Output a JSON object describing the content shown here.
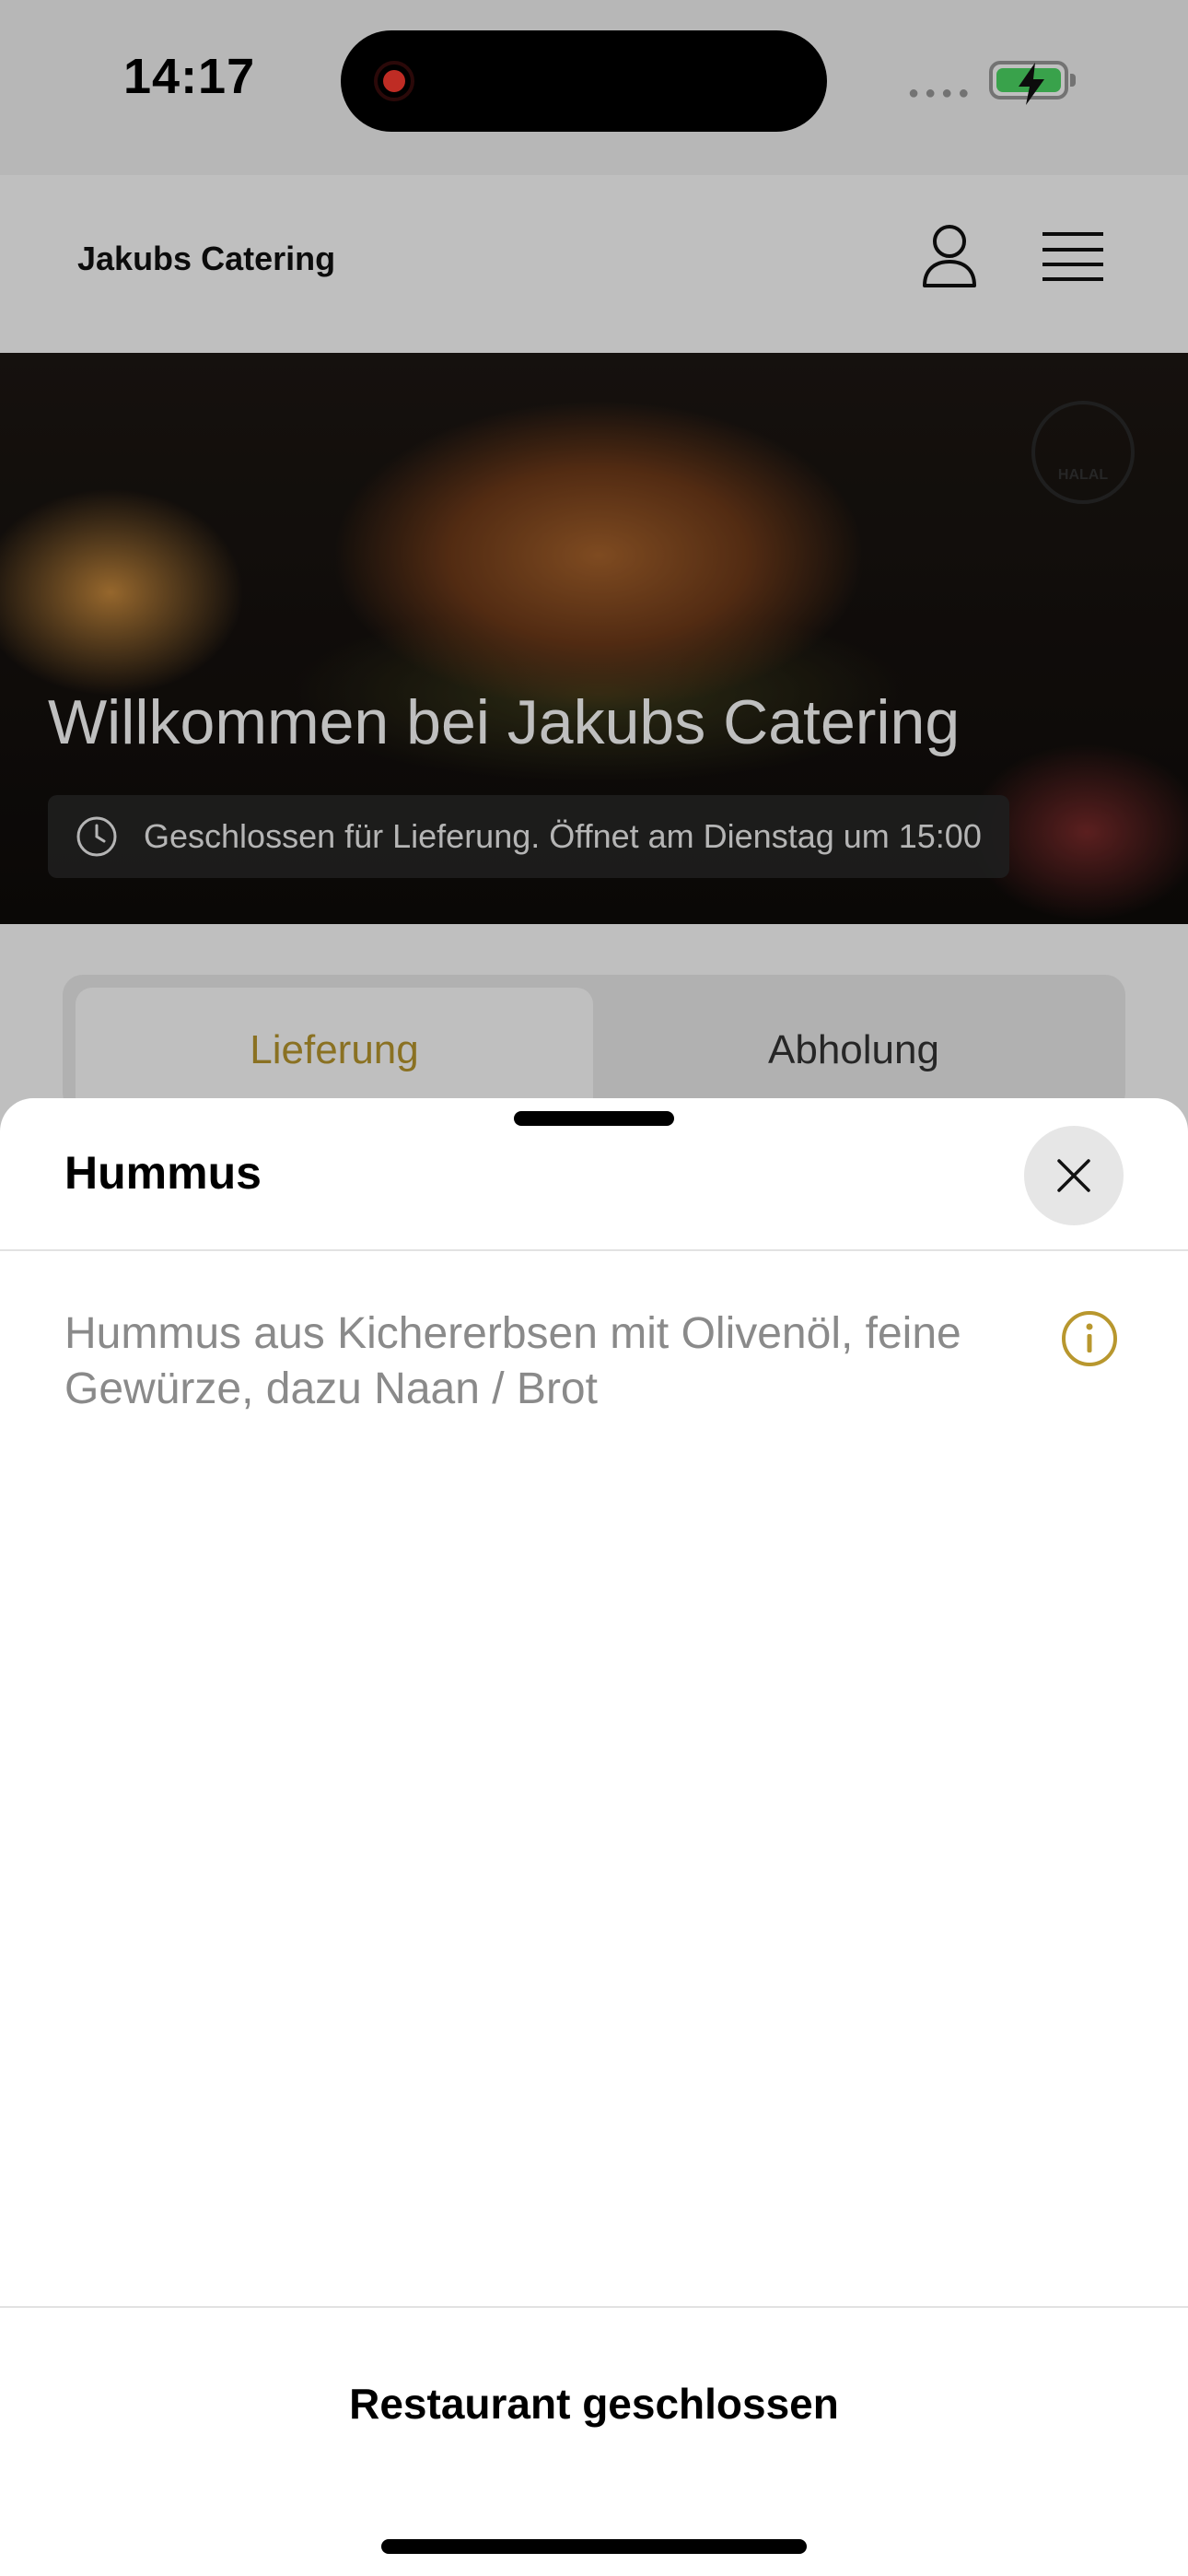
{
  "status_bar": {
    "time": "14:17"
  },
  "header": {
    "brand": "Jakubs Catering"
  },
  "hero": {
    "badge_text": "HALAL",
    "title": "Willkommen bei Jakubs Catering",
    "status": "Geschlossen für Lieferung. Öffnet am Dienstag um 15:00"
  },
  "tabs": [
    {
      "label": "Lieferung",
      "active": true
    },
    {
      "label": "Abholung",
      "active": false
    }
  ],
  "sheet": {
    "title": "Hummus",
    "description": "Hummus aus Kichererbsen mit Olivenöl, feine Gewürze, dazu Naan / Brot",
    "footer_label": "Restaurant geschlossen"
  },
  "colors": {
    "accent": "#b8972e",
    "battery": "#4cd964",
    "recording": "#ff3b30"
  },
  "icons": [
    "record-icon",
    "battery-icon",
    "user-icon",
    "menu-icon",
    "clock-icon",
    "close-icon",
    "info-icon"
  ]
}
